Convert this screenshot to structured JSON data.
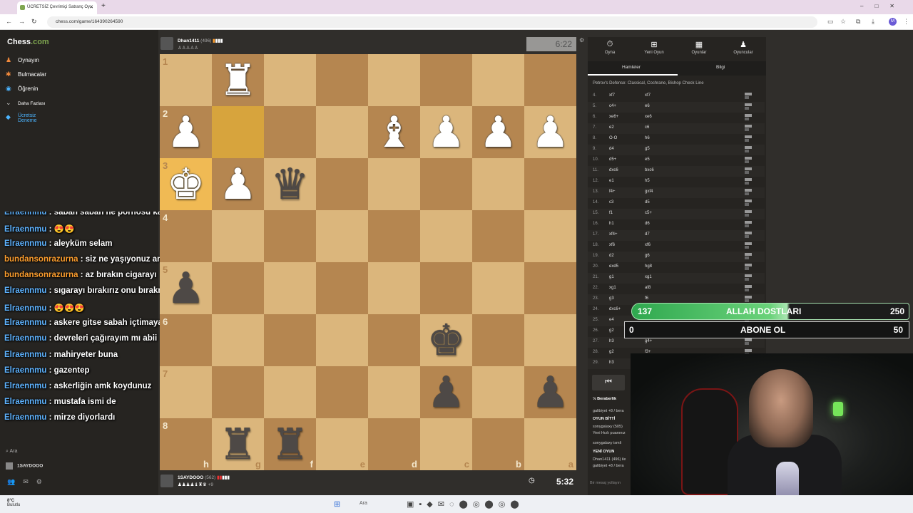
{
  "browser": {
    "tab_title": "ÜCRETSİZ Çevrimiçi Satranç Oy...",
    "url": "chess.com/game/164390264590"
  },
  "sidebar": {
    "logo": "Chess",
    "logo_suffix": ".com",
    "items": [
      {
        "label": "Oynayın",
        "icon": "pawn-icon"
      },
      {
        "label": "Bulmacalar",
        "icon": "puzzle-icon"
      },
      {
        "label": "Öğrenin",
        "icon": "learn-icon"
      },
      {
        "label": "Daha Fazlası",
        "icon": "chevron-down-icon"
      },
      {
        "label": "Ücretsiz Deneme",
        "icon": "diamond-icon"
      }
    ],
    "search": "Ara",
    "account": "1SAYDOOO"
  },
  "chat": [
    {
      "user": "Elraennmu",
      "msg": "sabah sabah ne pornosu kardeş",
      "cls": "u"
    },
    {
      "user": "Elraennmu",
      "msg": "😍😍",
      "cls": "u"
    },
    {
      "user": "Elraennmu",
      "msg": "aleyküm selam",
      "cls": "u"
    },
    {
      "user": "bundansonrazurna",
      "msg": "siz ne yaşıyonuz amk",
      "cls": "u2"
    },
    {
      "user": "bundansonrazurna",
      "msg": "az bırakın cigarayı",
      "cls": "u2"
    },
    {
      "user": "Elraennmu",
      "msg": "sıgarayı bırakırız onu bırakmayız gardaş",
      "cls": "u"
    },
    {
      "user": "Elraennmu",
      "msg": "😍😍😍",
      "cls": "u"
    },
    {
      "user": "Elraennmu",
      "msg": "askere gitse sabah içtimaya geç kalmazdı",
      "cls": "u"
    },
    {
      "user": "Elraennmu",
      "msg": "devreleri çağırayım mı abii",
      "cls": "u"
    },
    {
      "user": "Elraennmu",
      "msg": "mahiryeter buna",
      "cls": "u"
    },
    {
      "user": "Elraennmu",
      "msg": "gazentep",
      "cls": "u"
    },
    {
      "user": "Elraennmu",
      "msg": "askerliğin amk koydunuz",
      "cls": "u"
    },
    {
      "user": "Elraennmu",
      "msg": "mustafa ismi de",
      "cls": "u"
    },
    {
      "user": "Elraennmu",
      "msg": "mirze diyorlardı",
      "cls": "u"
    }
  ],
  "top_player": {
    "name": "Dhan1411",
    "rating": "(496)",
    "clock": "6:22"
  },
  "bottom_player": {
    "name": "1SAYDOOO",
    "rating": "(562)",
    "captured": "+9",
    "clock": "5:32"
  },
  "board": {
    "ranks": [
      "1",
      "2",
      "3",
      "4",
      "5",
      "6",
      "7",
      "8"
    ],
    "files": [
      "h",
      "g",
      "f",
      "e",
      "d",
      "c",
      "b",
      "a"
    ],
    "highlight": [
      [
        1,
        1
      ],
      [
        2,
        0
      ]
    ],
    "highlight_light": [
      [
        1,
        1
      ]
    ],
    "pieces": [
      {
        "r": 0,
        "c": 1,
        "p": "♜",
        "color": "w"
      },
      {
        "r": 1,
        "c": 0,
        "p": "♟",
        "color": "w"
      },
      {
        "r": 1,
        "c": 4,
        "p": "♝",
        "color": "w"
      },
      {
        "r": 1,
        "c": 5,
        "p": "♟",
        "color": "w"
      },
      {
        "r": 1,
        "c": 6,
        "p": "♟",
        "color": "w"
      },
      {
        "r": 1,
        "c": 7,
        "p": "♟",
        "color": "w"
      },
      {
        "r": 2,
        "c": 0,
        "p": "♚",
        "color": "w"
      },
      {
        "r": 2,
        "c": 1,
        "p": "♟",
        "color": "w"
      },
      {
        "r": 2,
        "c": 2,
        "p": "♛",
        "color": "b"
      },
      {
        "r": 4,
        "c": 0,
        "p": "♟",
        "color": "b"
      },
      {
        "r": 5,
        "c": 5,
        "p": "♚",
        "color": "b"
      },
      {
        "r": 6,
        "c": 5,
        "p": "♟",
        "color": "b"
      },
      {
        "r": 6,
        "c": 7,
        "p": "♟",
        "color": "b"
      },
      {
        "r": 7,
        "c": 1,
        "p": "♜",
        "color": "b"
      },
      {
        "r": 7,
        "c": 2,
        "p": "♜",
        "color": "b"
      }
    ]
  },
  "panel": {
    "tabs": [
      "Oyna",
      "Yeni Oyun",
      "Oyunlar",
      "Oyuncular"
    ],
    "subtabs": [
      "Hamleler",
      "Bilgi"
    ],
    "opening": "Petrov's Defense: Classical, Cochrane, Bishop Check Line",
    "moves": [
      {
        "n": "4.",
        "w": "xf7",
        "b": "xf7"
      },
      {
        "n": "5.",
        "w": "c4+",
        "b": "e6"
      },
      {
        "n": "6.",
        "w": "xe6+",
        "b": "xe6"
      },
      {
        "n": "7.",
        "w": "e2",
        "b": "c6"
      },
      {
        "n": "8.",
        "w": "O-O",
        "b": "h6"
      },
      {
        "n": "9.",
        "w": "d4",
        "b": "g5"
      },
      {
        "n": "10.",
        "w": "d5+",
        "b": "e5"
      },
      {
        "n": "11.",
        "w": "dxc6",
        "b": "bxc6"
      },
      {
        "n": "12.",
        "w": "e1",
        "b": "h5"
      },
      {
        "n": "13.",
        "w": "f4+",
        "b": "gxf4"
      },
      {
        "n": "14.",
        "w": "c3",
        "b": "d5"
      },
      {
        "n": "15.",
        "w": "f1",
        "b": "c5+"
      },
      {
        "n": "16.",
        "w": "h1",
        "b": "d6"
      },
      {
        "n": "17.",
        "w": "xf4+",
        "b": "d7"
      },
      {
        "n": "18.",
        "w": "xf6",
        "b": "xf6"
      },
      {
        "n": "19.",
        "w": "d2",
        "b": "g6"
      },
      {
        "n": "20.",
        "w": "exd5",
        "b": "hg8"
      },
      {
        "n": "21.",
        "w": "g1",
        "b": "xg1"
      },
      {
        "n": "22.",
        "w": "xg1",
        "b": "af8"
      },
      {
        "n": "23.",
        "w": "g3",
        "b": "f6"
      },
      {
        "n": "24.",
        "w": "dxc6+",
        "b": ""
      },
      {
        "n": "25.",
        "w": "e4",
        "b": ""
      },
      {
        "n": "26.",
        "w": "g2",
        "b": "xe4+"
      },
      {
        "n": "27.",
        "w": "h3",
        "b": "g4+"
      },
      {
        "n": "28.",
        "w": "g2",
        "b": "f3+"
      },
      {
        "n": "29.",
        "w": "h3",
        "b": ""
      }
    ],
    "draw": "Beraberlik",
    "info": [
      "galibiyet +8 / bera",
      "OYUN BİTTİ",
      "sonygalaxy (505)",
      "Yeni Hızlı puanınız",
      "sonygalaxy ismli",
      "YENİ OYUN",
      "Dhan1411 (496) ile",
      "galibiyet +8 / bera"
    ],
    "message_placeholder": "Bir mesaj yollayın"
  },
  "overlay": {
    "goal1_current": "137",
    "goal1_label": "ALLAH DOSTLARI",
    "goal1_target": "250",
    "goal2_current": "0",
    "goal2_label": "ABONE OL",
    "goal2_target": "50",
    "goal1_progress": 0.55,
    "goal2_progress": 0
  },
  "taskbar": {
    "weather_temp": "8°C",
    "weather_text": "Bulutlu",
    "search": "Ara"
  }
}
